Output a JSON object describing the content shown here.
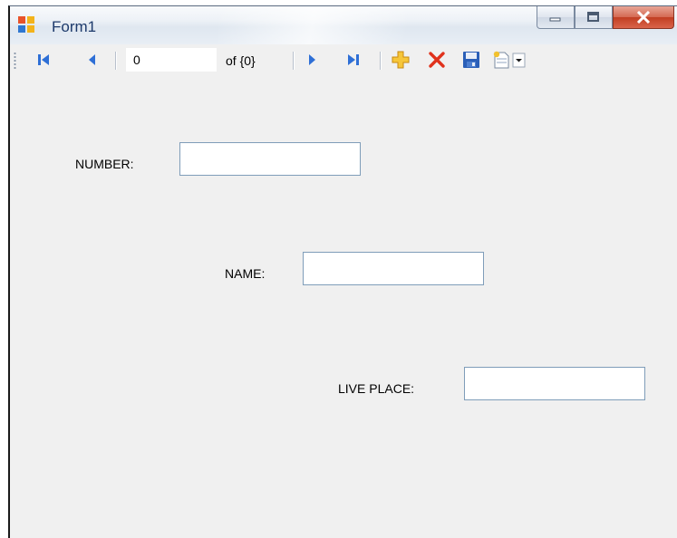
{
  "window": {
    "title": "Form1"
  },
  "caption": {
    "minimize_icon": "minimize-icon",
    "maximize_icon": "maximize-icon",
    "close_icon": "close-icon"
  },
  "navigator": {
    "position_value": "0",
    "count_label": "of {0}",
    "icons": [
      "move-first-icon",
      "move-previous-icon",
      "move-next-icon",
      "move-last-icon",
      "add-new-icon",
      "delete-icon",
      "save-icon",
      "new-item-dropdown-icon"
    ]
  },
  "form": {
    "number_label": "NUMBER:",
    "number_value": "",
    "name_label": "NAME:",
    "name_value": "",
    "live_place_label": "LIVE PLACE:",
    "live_place_value": ""
  }
}
